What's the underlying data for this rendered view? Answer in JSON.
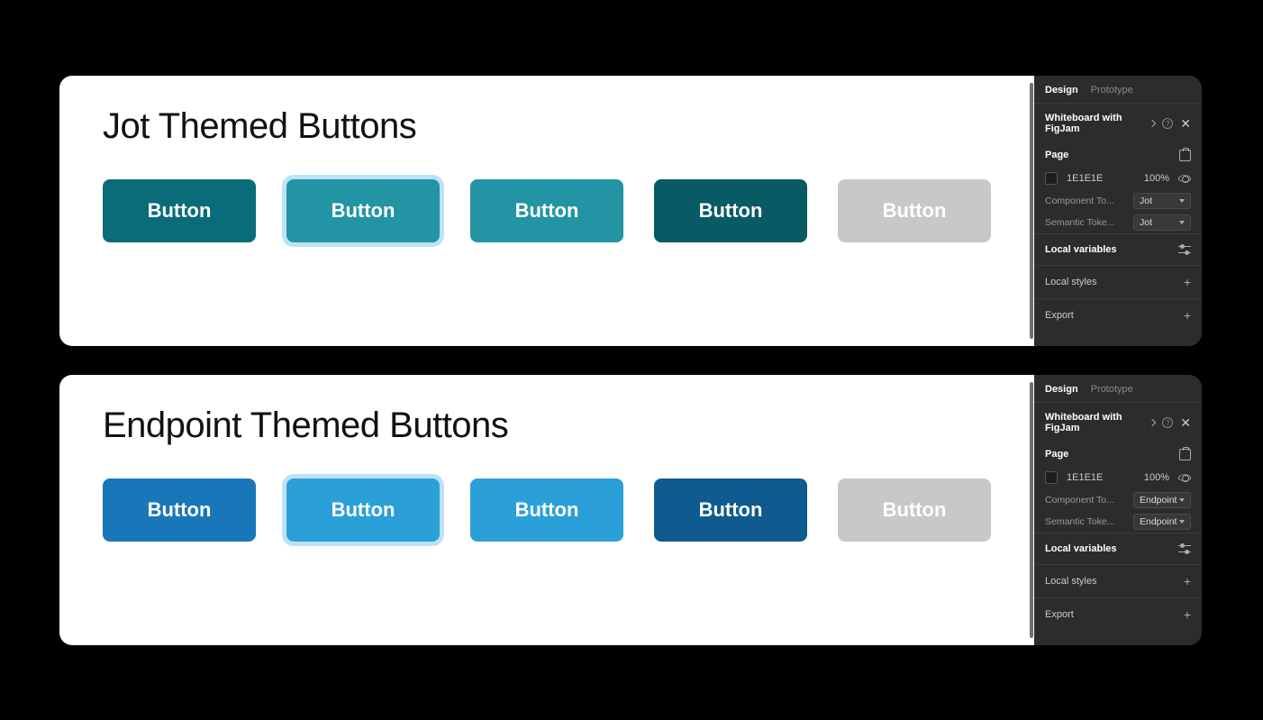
{
  "sections": [
    {
      "title": "Jot Themed Buttons",
      "theme": "Jot",
      "colors": {
        "primary": "#0a6c78",
        "hover": "#2294a3",
        "pressed": "#085a64",
        "disabled": "#c8c8c8",
        "focus_ring": "#bde1f5"
      },
      "buttons": [
        {
          "label": "Button",
          "state": "default",
          "interact": true
        },
        {
          "label": "Button",
          "state": "focus",
          "interact": true
        },
        {
          "label": "Button",
          "state": "hover",
          "interact": true
        },
        {
          "label": "Button",
          "state": "pressed",
          "interact": true
        },
        {
          "label": "Button",
          "state": "disabled",
          "interact": false
        }
      ],
      "panel": {
        "tabs": {
          "design": "Design",
          "prototype": "Prototype"
        },
        "filename": "Whiteboard with FigJam",
        "page_section": "Page",
        "fill_hex": "1E1E1E",
        "fill_opacity": "100%",
        "props": [
          {
            "label": "Component To...",
            "value": "Jot"
          },
          {
            "label": "Semantic Toke...",
            "value": "Jot"
          }
        ],
        "sections": {
          "local_vars": "Local variables",
          "local_styles": "Local styles",
          "export": "Export"
        }
      }
    },
    {
      "title": "Endpoint Themed Buttons",
      "theme": "Endpoint",
      "colors": {
        "primary": "#1976b8",
        "hover": "#2b9fd8",
        "pressed": "#0f5a8e",
        "disabled": "#c8c8c8",
        "focus_ring": "#bde1f5"
      },
      "buttons": [
        {
          "label": "Button",
          "state": "default",
          "interact": true
        },
        {
          "label": "Button",
          "state": "focus",
          "interact": true
        },
        {
          "label": "Button",
          "state": "hover",
          "interact": true
        },
        {
          "label": "Button",
          "state": "pressed",
          "interact": true
        },
        {
          "label": "Button",
          "state": "disabled",
          "interact": false
        }
      ],
      "panel": {
        "tabs": {
          "design": "Design",
          "prototype": "Prototype"
        },
        "filename": "Whiteboard with FigJam",
        "page_section": "Page",
        "fill_hex": "1E1E1E",
        "fill_opacity": "100%",
        "props": [
          {
            "label": "Component To...",
            "value": "Endpoint"
          },
          {
            "label": "Semantic Toke...",
            "value": "Endpoint"
          }
        ],
        "sections": {
          "local_vars": "Local variables",
          "local_styles": "Local styles",
          "export": "Export"
        }
      }
    }
  ]
}
